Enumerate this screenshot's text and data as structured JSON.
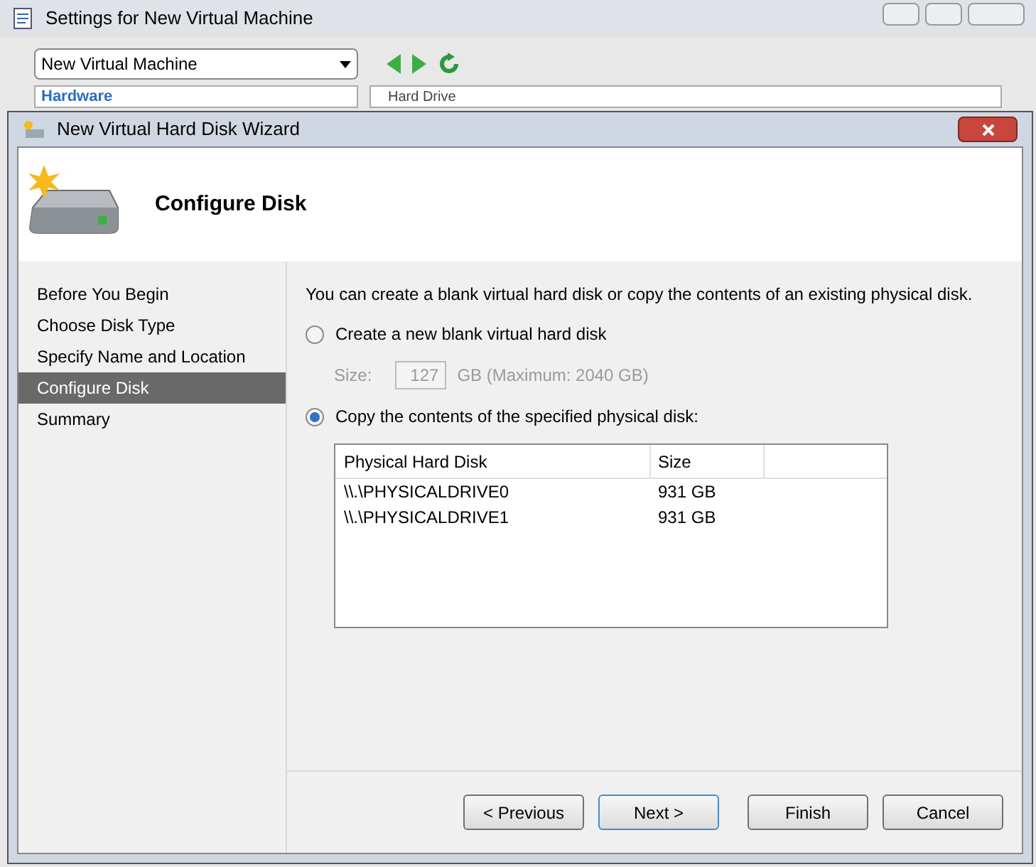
{
  "background_window": {
    "title": "Settings for New Virtual Machine",
    "machine_select": {
      "value": "New Virtual Machine"
    },
    "sidebar_heading": "Hardware",
    "detail_heading": "Hard Drive"
  },
  "wizard": {
    "title": "New Virtual Hard Disk Wizard",
    "heading": "Configure Disk",
    "steps": [
      {
        "label": "Before You Begin",
        "selected": false
      },
      {
        "label": "Choose Disk Type",
        "selected": false
      },
      {
        "label": "Specify Name and Location",
        "selected": false
      },
      {
        "label": "Configure Disk",
        "selected": true
      },
      {
        "label": "Summary",
        "selected": false
      }
    ],
    "intro": "You can create a blank virtual hard disk or copy the contents of an existing physical disk.",
    "options": [
      {
        "kind": "blank",
        "label": "Create a new blank virtual hard disk",
        "selected": false
      },
      {
        "kind": "copy",
        "label": "Copy the contents of the specified physical disk:",
        "selected": true
      }
    ],
    "size": {
      "label": "Size:",
      "value": "127",
      "unit": "GB (Maximum: 2040 GB)",
      "disabled": true
    },
    "table": {
      "columns": [
        "Physical Hard Disk",
        "Size"
      ],
      "rows": [
        [
          "\\\\.\\PHYSICALDRIVE0",
          "931 GB"
        ],
        [
          "\\\\.\\PHYSICALDRIVE1",
          "931 GB"
        ]
      ]
    },
    "buttons": [
      {
        "label": "< Previous",
        "default": false
      },
      {
        "label": "Next >",
        "default": true
      },
      {
        "label": "Finish",
        "default": false
      },
      {
        "label": "Cancel",
        "default": false
      }
    ]
  }
}
